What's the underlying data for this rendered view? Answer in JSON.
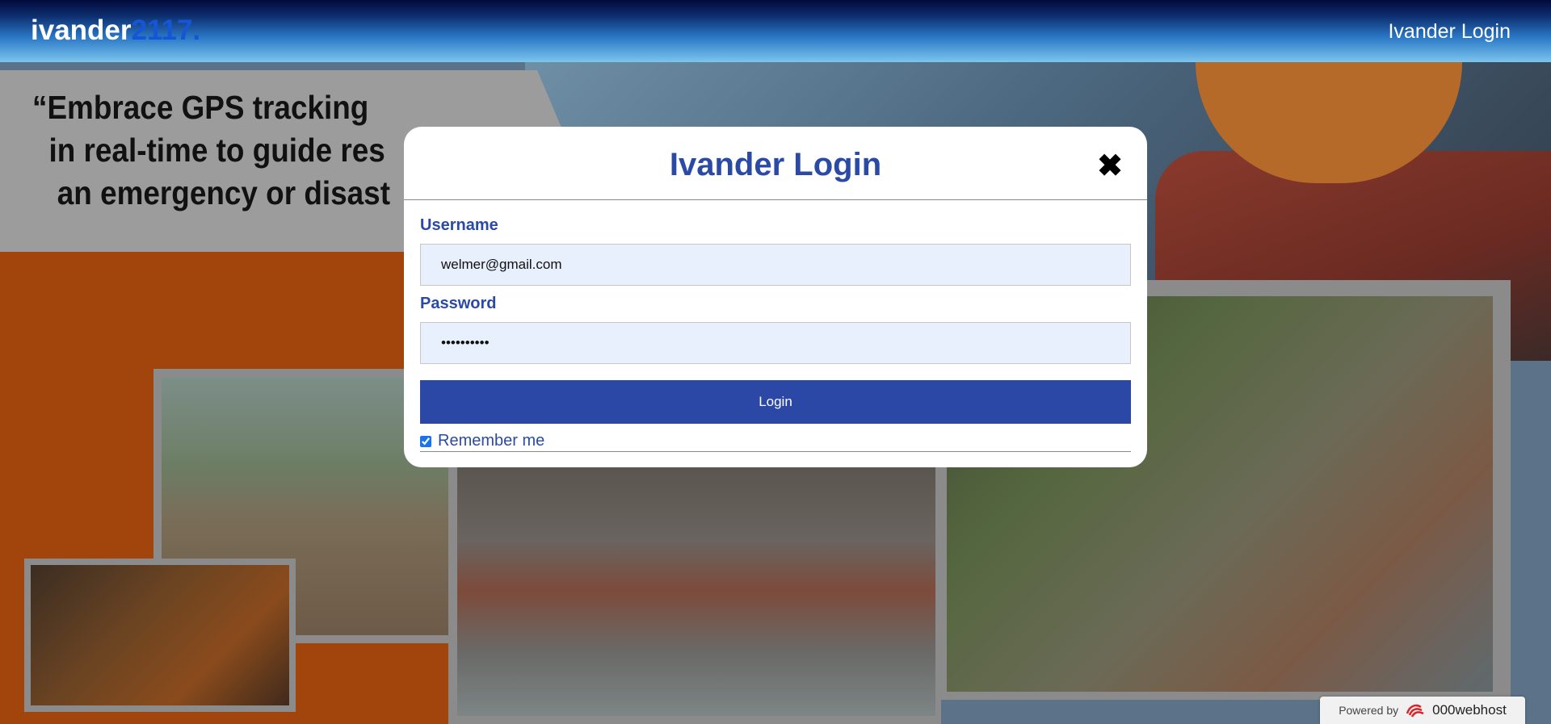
{
  "header": {
    "brand_main": "ivander",
    "brand_accent": "2117.",
    "nav_login": "Ivander Login"
  },
  "background": {
    "quote_lines": "“Embrace GPS tracking\n  in real-time to guide res\n   an emergency or disast"
  },
  "modal": {
    "title": "Ivander Login",
    "close_glyph": "✖",
    "username_label": "Username",
    "username_value": "welmer@gmail.com",
    "password_label": "Password",
    "password_value": "••••••••••",
    "login_button": "Login",
    "remember_label": "Remember me",
    "remember_checked": true
  },
  "footer": {
    "powered_by": "Powered by",
    "host_name": "000webhost",
    "host_icon": "000webhost-logo-icon"
  },
  "colors": {
    "accent": "#2b4aa5",
    "button": "#2b48a7",
    "input_bg": "#e8f0fe",
    "brand_accent": "#1556d8"
  }
}
